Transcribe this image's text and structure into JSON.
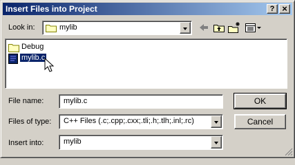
{
  "window": {
    "title": "Insert Files into Project",
    "help_label": "?",
    "close_label": "×"
  },
  "lookin": {
    "label": "Look in:",
    "value": "mylib"
  },
  "toolbar": {
    "back_icon": "back-arrow-icon",
    "up_icon": "up-one-level-icon",
    "new_folder_icon": "new-folder-icon",
    "view_menu_icon": "view-menu-icon"
  },
  "files": [
    {
      "name": "Debug",
      "type": "folder",
      "selected": false
    },
    {
      "name": "mylib.c",
      "type": "c-source-file",
      "selected": true
    }
  ],
  "form": {
    "filename_label": "File name:",
    "filename_value": "mylib.c",
    "filetype_label": "Files of type:",
    "filetype_value": "C++ Files (.c;.cpp;.cxx;.tli;.h;.tlh;.inl;.rc)",
    "insertinto_label": "Insert into:",
    "insertinto_value": "mylib"
  },
  "buttons": {
    "ok": "OK",
    "cancel": "Cancel"
  },
  "colors": {
    "titlebar_start": "#0a246a",
    "titlebar_end": "#a6caf0",
    "selection": "#0a246a",
    "face": "#d4d0c8"
  }
}
